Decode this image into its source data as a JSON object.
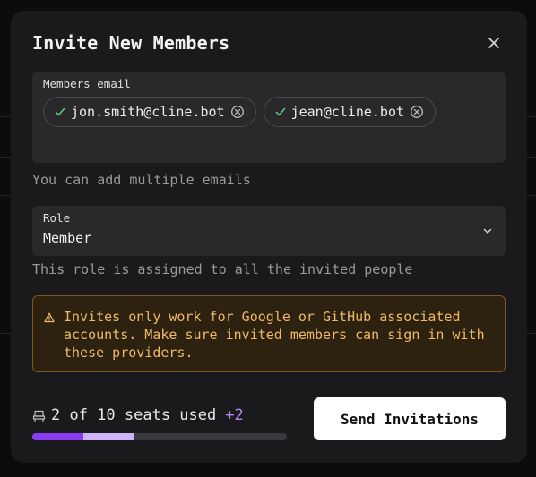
{
  "modal": {
    "title": "Invite New Members",
    "close_icon": "close-icon"
  },
  "emails": {
    "label": "Members email",
    "chips": [
      {
        "email": "jon.smith@cline.bot",
        "valid": true
      },
      {
        "email": "jean@cline.bot",
        "valid": true
      }
    ],
    "hint": "You can add multiple emails"
  },
  "role": {
    "label": "Role",
    "selected": "Member",
    "hint": "This role is assigned to all the invited people"
  },
  "warning": {
    "icon": "warning-icon",
    "text": "Invites only work for Google or GitHub associated\naccounts. Make sure invited members can sign in with\nthese providers."
  },
  "seats": {
    "icon": "seat-icon",
    "text": "2 of 10 seats used",
    "extra": "+2",
    "used": 2,
    "pending": 2,
    "total": 10
  },
  "actions": {
    "send_label": "Send Invitations"
  },
  "colors": {
    "accent": "#8a3cf0",
    "accent_light": "#cfb3f7",
    "warning_text": "#f0b86a"
  }
}
